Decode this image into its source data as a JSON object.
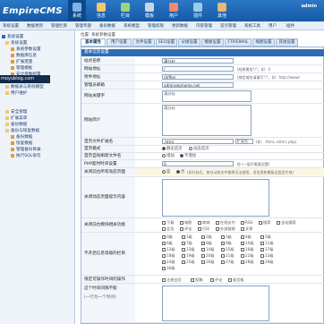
{
  "header": {
    "logo": "EmpireCMS",
    "admin": "admin",
    "nav": [
      {
        "label": "系统",
        "color": "#7fb3e6"
      },
      {
        "label": "信息",
        "color": "#f3c86b"
      },
      {
        "label": "栏目",
        "color": "#9fd27a"
      },
      {
        "label": "模板",
        "color": "#c8d6ea"
      },
      {
        "label": "用户",
        "color": "#f08a6a"
      },
      {
        "label": "插件",
        "color": "#9ccbea"
      },
      {
        "label": "其他",
        "color": "#e6b870"
      }
    ]
  },
  "subnav": [
    "系统设置",
    "数据更新",
    "管理栏目",
    "管理专题",
    "备份数据",
    "系统模型",
    "管理权限",
    "更新数据",
    "内容管理",
    "首页管理",
    "系统工具",
    "用户",
    "插件"
  ],
  "sidebar": {
    "items": [
      "系统设置",
      "系统设置",
      "系统参数设置",
      "数据库信息",
      "扩展变量",
      "管理模板",
      "安全参数配置",
      "后台首页",
      "数据表与系统模型",
      "用户维护",
      "安全管理",
      "扩展菜单",
      "备份数据",
      "备份与恢复数据",
      "备份数据",
      "恢复数据",
      "管理备份目录",
      "执行SQL语句"
    ],
    "watermark": "moyublog.com"
  },
  "crumb": "位置: 系统参数设置",
  "tabs": [
    "基本属性",
    "用户设置",
    "文件设置",
    "SEO设置",
    "分组设置",
    "模板设置",
    "FTP/EMAIL",
    "缩图设置",
    "其他设置"
  ],
  "form": {
    "title": "基本信息设置",
    "rows": [
      {
        "label": "站点名称",
        "value": "满分站",
        "hint": ""
      },
      {
        "label": "网站地址",
        "value": "/",
        "hint": "(结尾需加\"/\"，如：/)"
      },
      {
        "label": "附件地址",
        "value": "/d/file/",
        "hint": "(绑定域名请填写\"/\"，如：http://www/"
      },
      {
        "label": "管理员邮箱",
        "value": "admin@phome.net",
        "hint": ""
      },
      {
        "label": "网站关键字",
        "value": "满分站",
        "hint": ""
      },
      {
        "label": "网站简介",
        "value": "满分站",
        "hint": ""
      }
    ],
    "index_ext_label": "首页文件扩展名",
    "index_ext_value": ".html",
    "index_ext_select": "扩展名",
    "index_ext_hint": "(如：.html,.shtml,.php)",
    "index_mode_label": "首页模式",
    "index_mode_opts": [
      "静态首页",
      "动态首页"
    ],
    "index_refresh_label": "首页自动刷新文件名",
    "index_refresh_opts": [
      "增加",
      "不增加"
    ],
    "php_time_label": "PHP超时时间设置",
    "php_time_value": "0",
    "php_time_hint": "秒 (一般不需要设置)",
    "close_label": "关闭前台所有动态页面",
    "close_opts": [
      "是",
      "否"
    ],
    "close_hint": "(如开启后，前台动态文件都将无法使用，但信息和模板全面会生效)",
    "close_reason_label": "关闭动态页面提示内容",
    "close_mod_label": "关闭前台模块相关功能",
    "close_mods": [
      "下载",
      "电影",
      "商城",
      "在线支付",
      "RSS",
      "搜索",
      "全站搜索",
      "会员",
      "评论",
      "打印",
      "外部链接",
      "文章"
    ],
    "levels_label": "不开启信息等级的栏目",
    "levels": [
      "0级",
      "1级",
      "2级",
      "3级",
      "4级",
      "5级",
      "6级",
      "7级",
      "8级",
      "9级",
      "10级",
      "11级",
      "12级",
      "13级",
      "14级",
      "15级",
      "16级",
      "17级",
      "18级",
      "19级",
      "20级",
      "21级",
      "22级",
      "23级",
      "24级",
      "25级",
      "26级",
      "27级",
      "28级",
      "29级",
      "30级"
    ],
    "login_label": "限定可操作时间的操作",
    "login_opts": [
      "注册会员",
      "投稿",
      "评论",
      "留言板"
    ],
    "timelimit_label": "这个时间间隔不能",
    "timelimit_label2": "(一行为一个时间)"
  }
}
